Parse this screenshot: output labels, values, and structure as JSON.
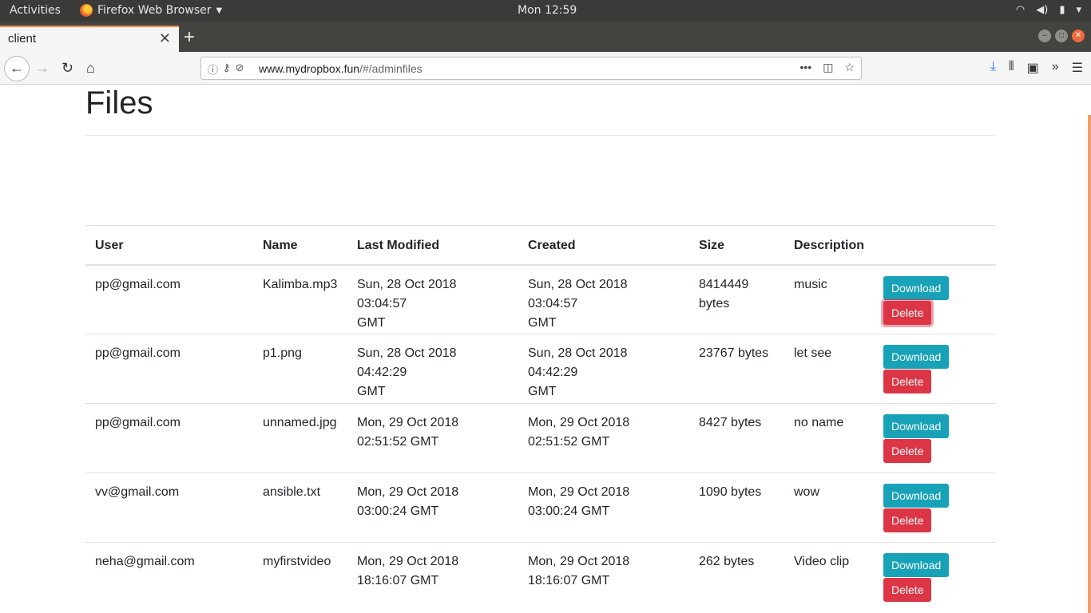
{
  "os_bar": {
    "activities": "Activities",
    "app_name": "Firefox Web Browser",
    "clock": "Mon 12:59"
  },
  "browser": {
    "tab_title": "client",
    "url_domain": "www.mydropbox.fun",
    "url_path": "/#/adminfiles"
  },
  "page": {
    "title": "Files"
  },
  "table": {
    "headers": [
      "User",
      "Name",
      "Last Modified",
      "Created",
      "Size",
      "Description"
    ],
    "rows": [
      {
        "user": "pp@gmail.com",
        "name": "Kalimba.mp3",
        "modified_l1": "Sun, 28 Oct 2018 03:04:57",
        "modified_l2": "GMT",
        "created_l1": "Sun, 28 Oct 2018 03:04:57",
        "created_l2": "GMT",
        "size_l1": "8414449",
        "size_l2": "bytes",
        "description": "music",
        "download_label": "Download",
        "delete_label": "Delete"
      },
      {
        "user": "pp@gmail.com",
        "name": "p1.png",
        "modified_l1": "Sun, 28 Oct 2018 04:42:29",
        "modified_l2": "GMT",
        "created_l1": "Sun, 28 Oct 2018 04:42:29",
        "created_l2": "GMT",
        "size_l1": "23767 bytes",
        "size_l2": "",
        "description": "let see",
        "download_label": "Download",
        "delete_label": "Delete"
      },
      {
        "user": "pp@gmail.com",
        "name": "unnamed.jpg",
        "modified_l1": "Mon, 29 Oct 2018",
        "modified_l2": "02:51:52 GMT",
        "created_l1": "Mon, 29 Oct 2018",
        "created_l2": "02:51:52 GMT",
        "size_l1": "8427 bytes",
        "size_l2": "",
        "description": "no name",
        "download_label": "Download",
        "delete_label": "Delete"
      },
      {
        "user": "vv@gmail.com",
        "name": "ansible.txt",
        "modified_l1": "Mon, 29 Oct 2018",
        "modified_l2": "03:00:24 GMT",
        "created_l1": "Mon, 29 Oct 2018",
        "created_l2": "03:00:24 GMT",
        "size_l1": "1090 bytes",
        "size_l2": "",
        "description": "wow",
        "download_label": "Download",
        "delete_label": "Delete"
      },
      {
        "user": "neha@gmail.com",
        "name": "myfirstvideo",
        "modified_l1": "Mon, 29 Oct 2018",
        "modified_l2": "18:16:07 GMT",
        "created_l1": "Mon, 29 Oct 2018",
        "created_l2": "18:16:07 GMT",
        "size_l1": "262 bytes",
        "size_l2": "",
        "description": "Video clip",
        "download_label": "Download",
        "delete_label": "Delete"
      }
    ]
  },
  "colors": {
    "download": "#17a2b8",
    "delete": "#dc3545",
    "tab_accent": "#ff8a3d"
  },
  "icons": [
    "firefox-icon",
    "wifi-icon",
    "volume-icon",
    "battery-icon",
    "back-icon",
    "forward-icon",
    "reload-icon",
    "home-icon",
    "info-icon",
    "key-icon",
    "tracking-icon",
    "more-icon",
    "pocket-icon",
    "bookmark-star-icon",
    "download-icon",
    "library-icon",
    "sidebar-icon",
    "overflow-icon",
    "menu-icon",
    "close-tab-icon",
    "new-tab-icon"
  ]
}
